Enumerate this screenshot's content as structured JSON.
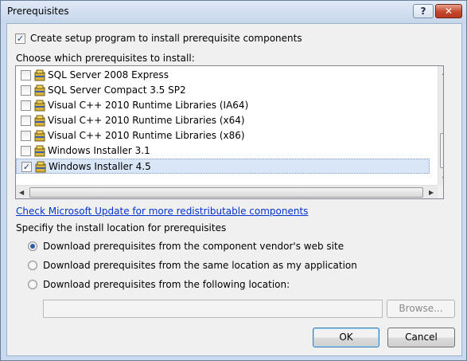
{
  "window": {
    "title": "Prerequisites",
    "help_label": "?",
    "close_label": "✕"
  },
  "create_setup": {
    "checked": true,
    "label": "Create setup program to install prerequisite components"
  },
  "choose_label": "Choose which prerequisites to install:",
  "prerequisites": [
    {
      "label": "SQL Server 2008 Express",
      "checked": false,
      "selected": false
    },
    {
      "label": "SQL Server Compact 3.5 SP2",
      "checked": false,
      "selected": false
    },
    {
      "label": "Visual C++ 2010 Runtime Libraries (IA64)",
      "checked": false,
      "selected": false
    },
    {
      "label": "Visual C++ 2010 Runtime Libraries (x64)",
      "checked": false,
      "selected": false
    },
    {
      "label": "Visual C++ 2010 Runtime Libraries (x86)",
      "checked": false,
      "selected": false
    },
    {
      "label": "Windows Installer 3.1",
      "checked": false,
      "selected": false
    },
    {
      "label": "Windows Installer 4.5",
      "checked": true,
      "selected": true
    }
  ],
  "check_mark": "✓",
  "update_link": "Check Microsoft Update for more redistributable components",
  "location_heading": "Specifiy the install location for prerequisites",
  "location_options": [
    {
      "label": "Download prerequisites from the component vendor's web site",
      "selected": true
    },
    {
      "label": "Download prerequisites from the same location as my application",
      "selected": false
    },
    {
      "label": "Download prerequisites from the following location:",
      "selected": false
    }
  ],
  "location_path": "",
  "buttons": {
    "browse": "Browse...",
    "ok": "OK",
    "cancel": "Cancel"
  },
  "colors": {
    "link": "#0033cc",
    "selection": "#d9e6f7",
    "titlebar": "#c9d9ef"
  },
  "icons": {
    "prerequisite": "package-icon"
  }
}
